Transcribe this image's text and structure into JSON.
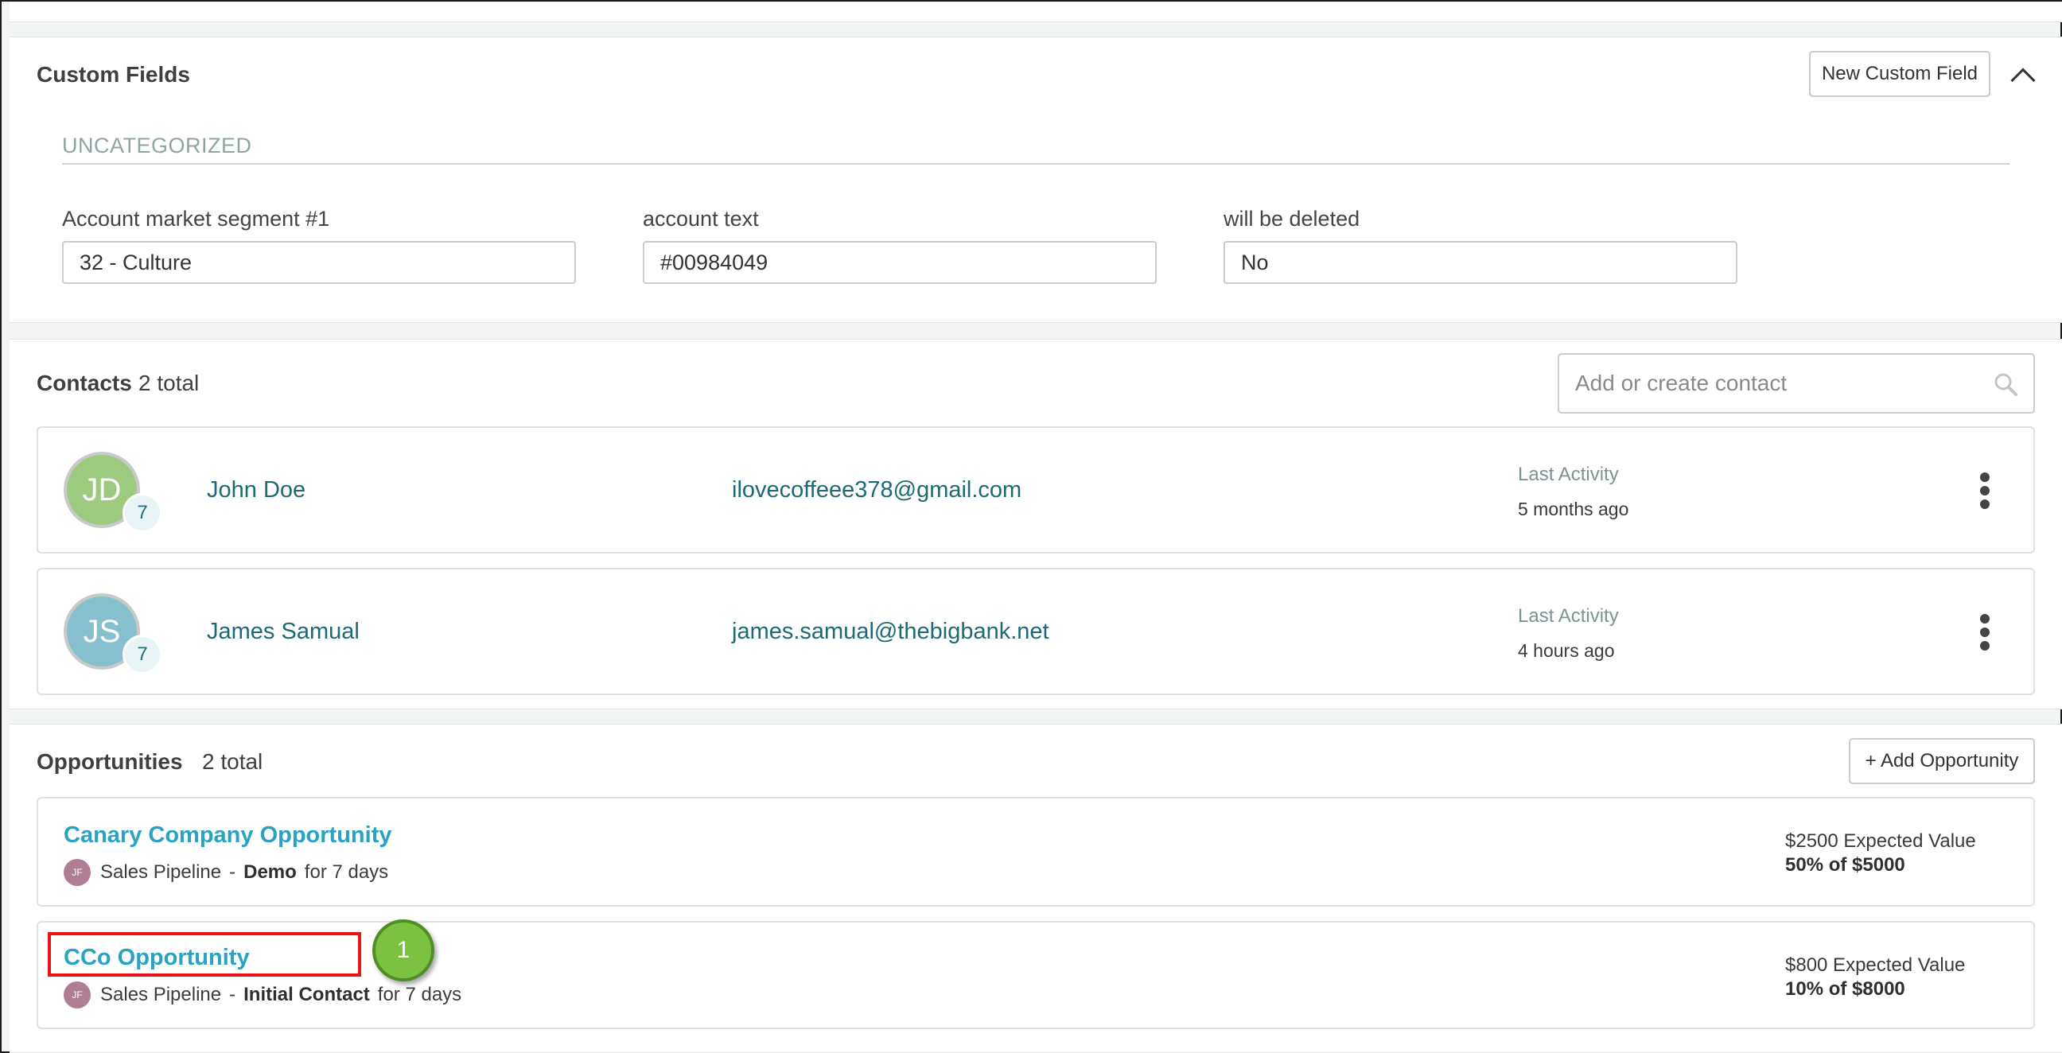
{
  "custom_fields": {
    "title": "Custom Fields",
    "new_button": "New Custom Field",
    "group_label": "UNCATEGORIZED",
    "fields": [
      {
        "label": "Account market segment #1",
        "value": "32 - Culture"
      },
      {
        "label": "account text",
        "value": "#00984049"
      },
      {
        "label": "will be deleted",
        "value": "No"
      }
    ]
  },
  "contacts": {
    "title": "Contacts",
    "count": "2 total",
    "search_placeholder": "Add or create contact",
    "items": [
      {
        "initials": "JD",
        "avatar_color": "#9ccb7f",
        "badge": "7",
        "name": "John Doe",
        "email": "ilovecoffeee378@gmail.com",
        "activity_label": "Last Activity",
        "activity_value": "5 months ago"
      },
      {
        "initials": "JS",
        "avatar_color": "#86c0cf",
        "badge": "7",
        "name": "James Samual",
        "email": "james.samual@thebigbank.net",
        "activity_label": "Last Activity",
        "activity_value": "4 hours ago"
      }
    ]
  },
  "opportunities": {
    "title": "Opportunities",
    "count": "2 total",
    "add_button": "+ Add Opportunity",
    "items": [
      {
        "title": "Canary Company Opportunity",
        "owner_initials": "JF",
        "pipeline": "Sales Pipeline",
        "separator": "-",
        "stage": "Demo",
        "duration": "for 7 days",
        "expected_value": "$2500 Expected Value",
        "probability": "50% of $5000"
      },
      {
        "title": "CCo Opportunity",
        "owner_initials": "JF",
        "pipeline": "Sales Pipeline",
        "separator": "-",
        "stage": "Initial Contact",
        "duration": "for 7 days",
        "expected_value": "$800 Expected Value",
        "probability": "10% of $8000"
      }
    ]
  },
  "annotation": {
    "step_number": "1",
    "highlight_color": "#e8141a",
    "marker_color": "#7cc241"
  }
}
